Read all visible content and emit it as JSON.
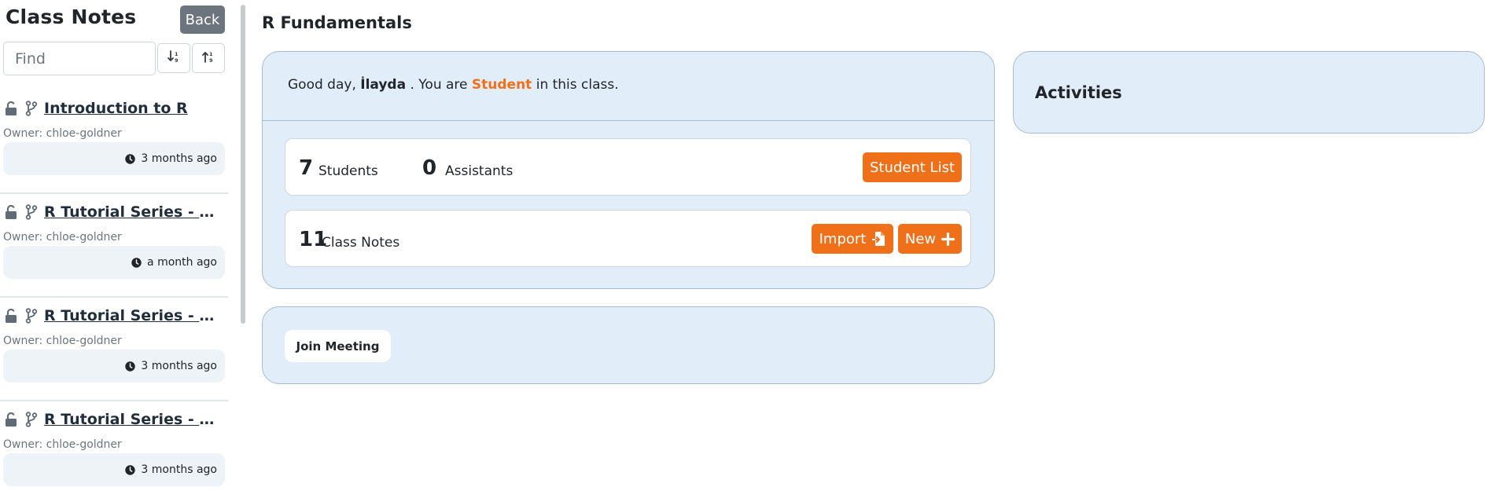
{
  "sidebar": {
    "title": "Class Notes",
    "back_label": "Back",
    "search": {
      "placeholder": "Find",
      "value": ""
    },
    "notes": [
      {
        "title": "Introduction to R",
        "owner": "Owner: chloe-goldner",
        "updated": "3 months ago"
      },
      {
        "title": "R Tutorial Series - Sum…",
        "owner": "Owner: chloe-goldner",
        "updated": "a month ago"
      },
      {
        "title": "R Tutorial Series - Simpl…",
        "owner": "Owner: chloe-goldner",
        "updated": "3 months ago"
      },
      {
        "title": "R Tutorial Series - Graph…",
        "owner": "Owner: chloe-goldner",
        "updated": "3 months ago"
      }
    ]
  },
  "main": {
    "title": "R Fundamentals",
    "greeting": {
      "prefix": "Good day, ",
      "user": "İlayda",
      "middle": " . You are ",
      "role": "Student",
      "suffix": " in this class."
    },
    "stats": {
      "students_count": "7",
      "students_label": "Students",
      "assistants_count": "0",
      "assistants_label": "Assistants",
      "student_list_label": "Student List",
      "notes_count": "11",
      "notes_label": "Class Notes",
      "import_label": "Import",
      "new_label": "New"
    },
    "meeting": {
      "join_label": "Join Meeting"
    },
    "activities": {
      "title": "Activities"
    }
  },
  "colors": {
    "accent": "#f07019",
    "card_bg": "#e1edf8",
    "back_button": "#6c757d"
  }
}
